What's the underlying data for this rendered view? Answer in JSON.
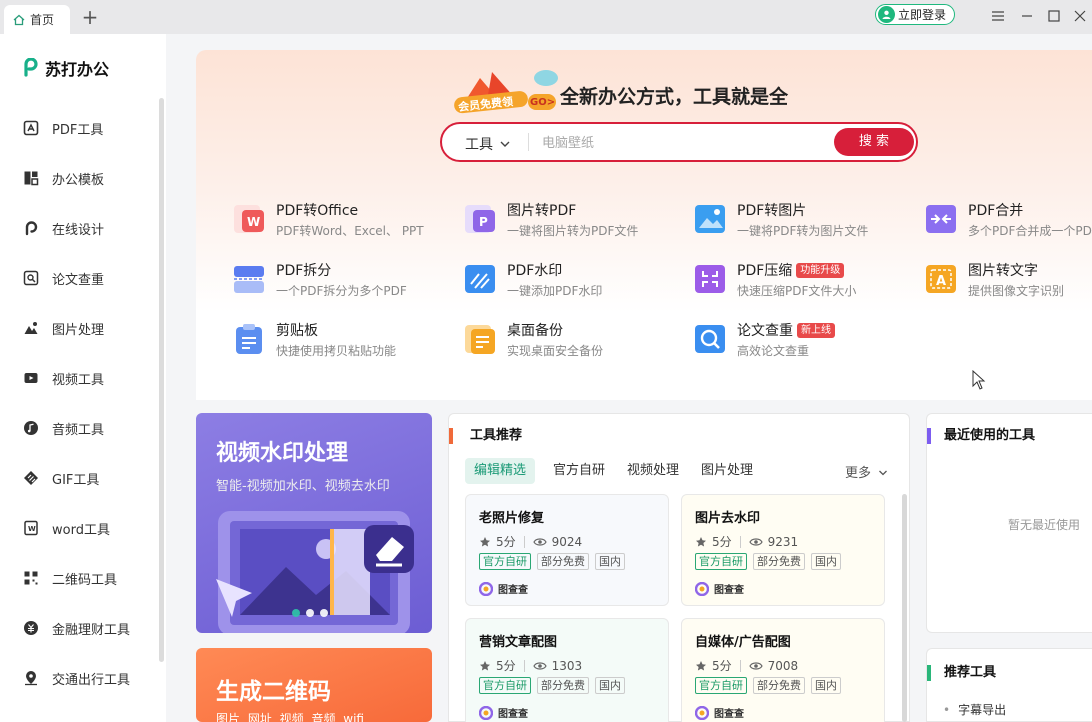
{
  "titlebar": {
    "tab_label": "首页",
    "add_tab": "+",
    "login_label": "立即登录"
  },
  "sidebar": {
    "logo": "苏打办公",
    "items": [
      {
        "label": "PDF工具",
        "icon": "pdf-icon"
      },
      {
        "label": "办公模板",
        "icon": "template-icon"
      },
      {
        "label": "在线设计",
        "icon": "design-icon"
      },
      {
        "label": "论文查重",
        "icon": "paper-check-icon"
      },
      {
        "label": "图片处理",
        "icon": "image-icon"
      },
      {
        "label": "视频工具",
        "icon": "video-icon"
      },
      {
        "label": "音频工具",
        "icon": "audio-icon"
      },
      {
        "label": "GIF工具",
        "icon": "gif-icon"
      },
      {
        "label": "word工具",
        "icon": "word-icon"
      },
      {
        "label": "二维码工具",
        "icon": "qrcode-icon"
      },
      {
        "label": "金融理财工具",
        "icon": "finance-icon"
      },
      {
        "label": "交通出行工具",
        "icon": "location-icon"
      }
    ]
  },
  "hero": {
    "promo": "会员免费领",
    "promo_go": "GO>",
    "slogan": "全新办公方式，工具就是全",
    "search": {
      "category": "工具",
      "placeholder": "电脑壁纸",
      "button": "搜 索"
    }
  },
  "tools": [
    {
      "name": "PDF转Office",
      "desc": "PDF转Word、Excel、 PPT",
      "badge": "",
      "color": "#ef5a5a"
    },
    {
      "name": "图片转PDF",
      "desc": "一键将图片转为PDF文件",
      "badge": "",
      "color": "#8f66e8"
    },
    {
      "name": "PDF转图片",
      "desc": "一键将PDF转为图片文件",
      "badge": "",
      "color": "#3a9ef0"
    },
    {
      "name": "PDF合并",
      "desc": "多个PDF合并成一个PDF",
      "badge": "",
      "color": "#8b6ff0"
    },
    {
      "name": "PDF拆分",
      "desc": "一个PDF拆分为多个PDF",
      "badge": "",
      "color": "#5b7cf0"
    },
    {
      "name": "PDF水印",
      "desc": "一键添加PDF水印",
      "badge": "",
      "color": "#3a8ef0"
    },
    {
      "name": "PDF压缩",
      "desc": "快速压缩PDF文件大小",
      "badge": "功能升级",
      "color": "#9c5ce8"
    },
    {
      "name": "图片转文字",
      "desc": "提供图像文字识别",
      "badge": "",
      "color": "#f5a623"
    },
    {
      "name": "剪贴板",
      "desc": "快捷使用拷贝粘贴功能",
      "badge": "",
      "color": "#5b8ef0"
    },
    {
      "name": "桌面备份",
      "desc": "实现桌面安全备份",
      "badge": "",
      "color": "#f5a623"
    },
    {
      "name": "论文查重",
      "desc": "高效论文查重",
      "badge": "新上线",
      "color": "#3a8ef0"
    }
  ],
  "banners": {
    "video": {
      "title": "视频水印处理",
      "subtitle": "智能-视频加水印、视频去水印"
    },
    "qr": {
      "title": "生成二维码",
      "subtitle": "图片 网址 视频 音频 wifi"
    }
  },
  "recommend": {
    "title": "工具推荐",
    "tabs": [
      "编辑精选",
      "官方自研",
      "视频处理",
      "图片处理"
    ],
    "more": "更多",
    "cards": [
      {
        "title": "老照片修复",
        "rating": "5分",
        "views": "9024",
        "tags": [
          "官方自研",
          "部分免费",
          "国内"
        ],
        "source": "图查查"
      },
      {
        "title": "图片去水印",
        "rating": "5分",
        "views": "9231",
        "tags": [
          "官方自研",
          "部分免费",
          "国内"
        ],
        "source": "图查查"
      },
      {
        "title": "营销文章配图",
        "rating": "5分",
        "views": "1303",
        "tags": [
          "官方自研",
          "部分免费",
          "国内"
        ],
        "source": "图查查"
      },
      {
        "title": "自媒体/广告配图",
        "rating": "5分",
        "views": "7008",
        "tags": [
          "官方自研",
          "部分免费",
          "国内"
        ],
        "source": "图查查"
      }
    ]
  },
  "recent": {
    "title": "最近使用的工具",
    "empty": "暂无最近使用"
  },
  "recommended_tools": {
    "title": "推荐工具",
    "items": [
      "字幕导出"
    ]
  }
}
